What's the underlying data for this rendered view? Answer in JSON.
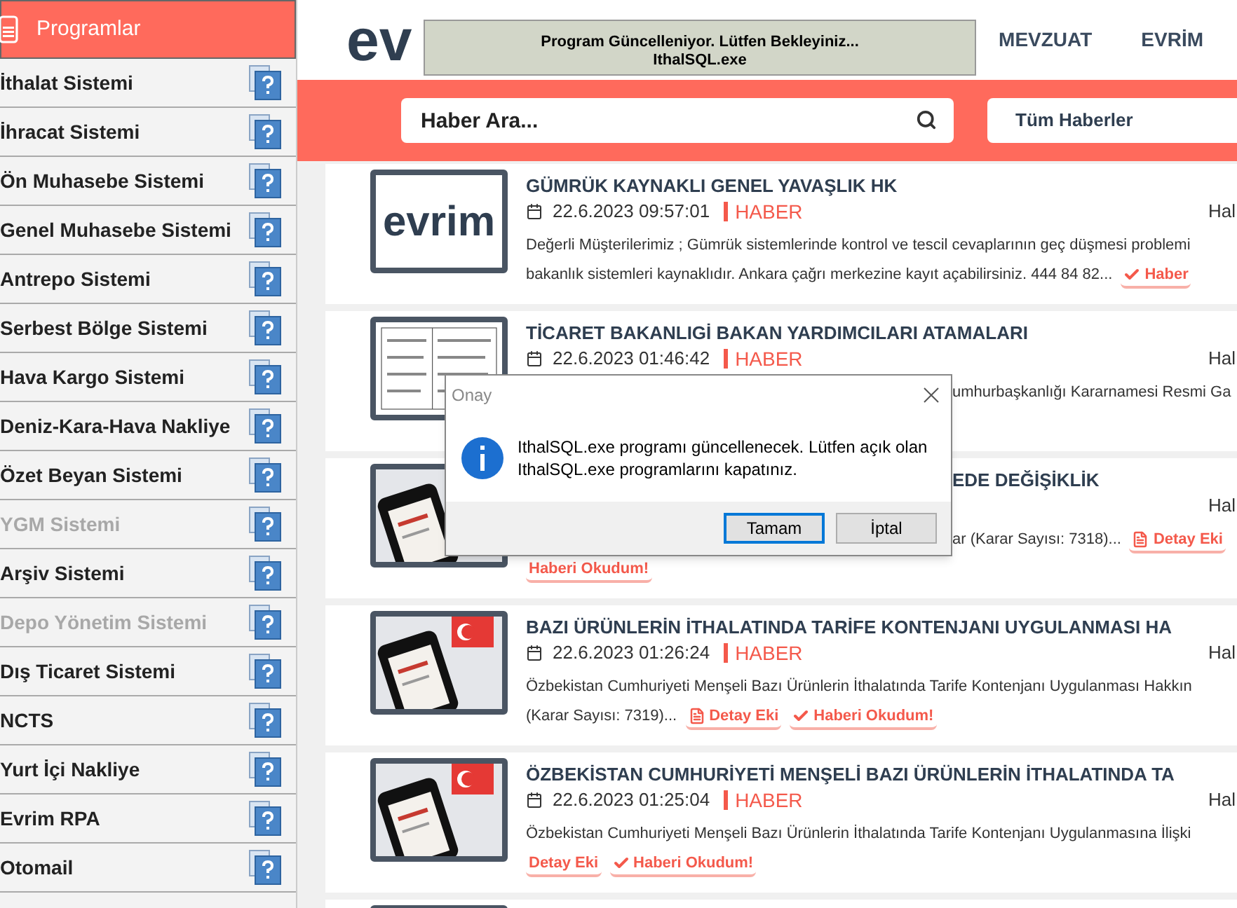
{
  "sidebar": {
    "title": "Programlar",
    "items": [
      {
        "label": "İthalat Sistemi",
        "disabled": false
      },
      {
        "label": "İhracat Sistemi",
        "disabled": false
      },
      {
        "label": "Ön Muhasebe Sistemi",
        "disabled": false
      },
      {
        "label": "Genel Muhasebe Sistemi",
        "disabled": false
      },
      {
        "label": "Antrepo Sistemi",
        "disabled": false
      },
      {
        "label": "Serbest Bölge Sistemi",
        "disabled": false
      },
      {
        "label": "Hava Kargo Sistemi",
        "disabled": false
      },
      {
        "label": "Deniz-Kara-Hava Nakliye",
        "disabled": false
      },
      {
        "label": "Özet Beyan Sistemi",
        "disabled": false
      },
      {
        "label": "YGM Sistemi",
        "disabled": true
      },
      {
        "label": "Arşiv Sistemi",
        "disabled": false
      },
      {
        "label": "Depo Yönetim Sistemi",
        "disabled": true
      },
      {
        "label": "Dış Ticaret Sistemi",
        "disabled": false
      },
      {
        "label": "NCTS",
        "disabled": false
      },
      {
        "label": "Yurt İçi Nakliye",
        "disabled": false
      },
      {
        "label": "Evrim RPA",
        "disabled": false
      },
      {
        "label": "Otomail",
        "disabled": false
      }
    ]
  },
  "header": {
    "logo": "ev",
    "nav": [
      "MEVZUAT",
      "EVRİM"
    ]
  },
  "search": {
    "placeholder": "Haber Ara...",
    "filter": "Tüm Haberler"
  },
  "news": [
    {
      "kind": "full",
      "thumbnail": {
        "kind": "logo",
        "text": "evrim"
      },
      "title": "GÜMRÜK KAYNAKLI GENEL YAVAŞLIK HK",
      "date": "22.6.2023 09:57:01",
      "category": "HABER",
      "meta": "Hal",
      "lines": [
        {
          "text": "Değerli Müşterilerimiz ; Gümrük sistemlerinde kontrol ve tescil cevaplarının geç düşmesi problemi"
        },
        {
          "text": "bakanlık sistemleri kaynaklıdır. Ankara çağrı merkezine kayıt açabilirsiniz. 444 84 82...",
          "actions": [
            {
              "kind": "check",
              "label": "Haber"
            }
          ]
        }
      ]
    },
    {
      "kind": "full",
      "thumbnail": {
        "kind": "document"
      },
      "title": "TİCARET BAKANLIGİ BAKAN YARDIMCILARI ATAMALARI",
      "date": "22.6.2023 01:46:42",
      "category": "HABER",
      "meta": "Hal",
      "lines": [
        {
          "text": "umhurbaşkanlığı Kararnamesi Resmi Ga",
          "kind": "occluded"
        }
      ]
    },
    {
      "kind": "occluded",
      "title": "EDE DEĞİŞİKLİK",
      "meta": "Hal",
      "lines": [
        {
          "text": "ar (Karar Sayısı: 7318)...",
          "kind": "occluded",
          "actions": [
            {
              "kind": "pdf",
              "label": "Detay Eki"
            }
          ]
        },
        {
          "kind": "plain",
          "actions": [
            {
              "kind": "plain",
              "label": "Haberi Okudum!"
            }
          ]
        }
      ]
    },
    {
      "kind": "full",
      "title": "BAZI ÜRÜNLERİN İTHALATINDA TARİFE KONTENJANI UYGULANMASI HA",
      "date": "22.6.2023 01:26:24",
      "category": "HABER",
      "meta": "Hal",
      "lines": [
        {
          "text": "Özbekistan Cumhuriyeti Menşeli Bazı Ürünlerin İthalatında Tarife Kontenjanı Uygulanması Hakkın"
        },
        {
          "text": "(Karar Sayısı: 7319)...",
          "actions": [
            {
              "kind": "pdf",
              "label": "Detay Eki"
            },
            {
              "kind": "check",
              "label": "Haberi Okudum!"
            }
          ]
        }
      ]
    },
    {
      "kind": "full",
      "title": "ÖZBEKİSTAN CUMHURİYETİ MENŞELİ BAZI ÜRÜNLERİN İTHALATINDA TA",
      "date": "22.6.2023 01:25:04",
      "category": "HABER",
      "meta": "Hal",
      "lines": [
        {
          "text": "Özbekistan Cumhuriyeti Menşeli Bazı Ürünlerin İthalatında Tarife Kontenjanı Uygulanmasına İlişki"
        },
        {
          "actions": [
            {
              "kind": "plain",
              "label": "Detay Eki"
            },
            {
              "kind": "check",
              "label": "Haberi Okudum!"
            }
          ]
        }
      ]
    },
    {
      "kind": "stub"
    }
  ],
  "progress": {
    "lines": [
      "Program Güncelleniyor. Lütfen Bekleyiniz...",
      "IthalSQL.exe"
    ]
  },
  "dialog": {
    "title": "Onay",
    "message": "IthalSQL.exe programı güncellenecek. Lütfen açık olan IthalSQL.exe programlarını kapatınız.",
    "buttons": [
      {
        "label": "Tamam",
        "selected": true
      },
      {
        "label": "İptal",
        "selected": false
      }
    ]
  }
}
